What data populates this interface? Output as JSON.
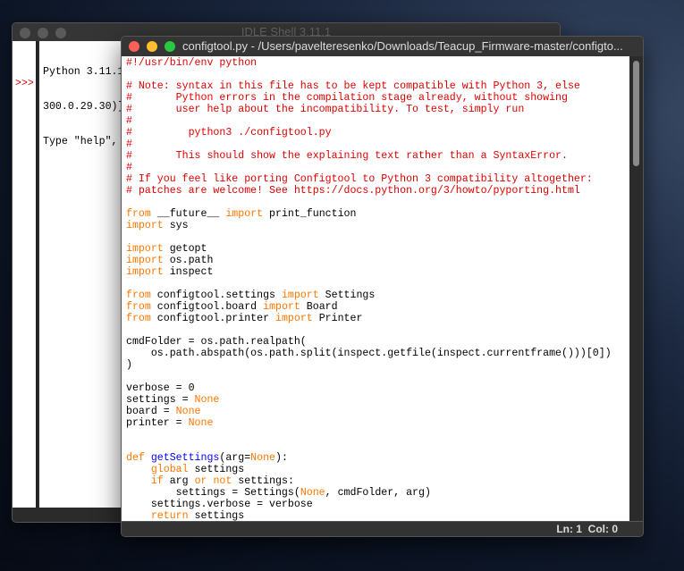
{
  "shell": {
    "title": "IDLE Shell 3.11.1",
    "lines": [
      "Python 3.11.1",
      "300.0.29.30)]",
      "Type \"help\","
    ],
    "prompt": ">>>"
  },
  "editor": {
    "title": "configtool.py - /Users/pavelteresenko/Downloads/Teacup_Firmware-master/configto...",
    "status": {
      "ln": "Ln: 1",
      "col": "Col: 0"
    },
    "lines": [
      [
        [
          "c",
          "#!/usr/bin/env python"
        ]
      ],
      [],
      [
        [
          "c",
          "# Note: syntax in this file has to be kept compatible with Python 3, else"
        ]
      ],
      [
        [
          "c",
          "#       Python errors in the compilation stage already, without showing"
        ]
      ],
      [
        [
          "c",
          "#       user help about the incompatibility. To test, simply run"
        ]
      ],
      [
        [
          "c",
          "#"
        ]
      ],
      [
        [
          "c",
          "#         python3 ./configtool.py"
        ]
      ],
      [
        [
          "c",
          "#"
        ]
      ],
      [
        [
          "c",
          "#       This should show the explaining text rather than a SyntaxError."
        ]
      ],
      [
        [
          "c",
          "#"
        ]
      ],
      [
        [
          "c",
          "# If you feel like porting Configtool to Python 3 compatibility altogether:"
        ]
      ],
      [
        [
          "c",
          "# patches are welcome! See https://docs.python.org/3/howto/pyporting.html"
        ]
      ],
      [],
      [
        [
          "k",
          "from"
        ],
        [
          "n",
          " __future__ "
        ],
        [
          "k",
          "import"
        ],
        [
          "n",
          " print_function"
        ]
      ],
      [
        [
          "k",
          "import"
        ],
        [
          "n",
          " sys"
        ]
      ],
      [],
      [
        [
          "k",
          "import"
        ],
        [
          "n",
          " getopt"
        ]
      ],
      [
        [
          "k",
          "import"
        ],
        [
          "n",
          " os.path"
        ]
      ],
      [
        [
          "k",
          "import"
        ],
        [
          "n",
          " inspect"
        ]
      ],
      [],
      [
        [
          "k",
          "from"
        ],
        [
          "n",
          " configtool.settings "
        ],
        [
          "k",
          "import"
        ],
        [
          "n",
          " Settings"
        ]
      ],
      [
        [
          "k",
          "from"
        ],
        [
          "n",
          " configtool.board "
        ],
        [
          "k",
          "import"
        ],
        [
          "n",
          " Board"
        ]
      ],
      [
        [
          "k",
          "from"
        ],
        [
          "n",
          " configtool.printer "
        ],
        [
          "k",
          "import"
        ],
        [
          "n",
          " Printer"
        ]
      ],
      [],
      [
        [
          "n",
          "cmdFolder = os.path.realpath("
        ]
      ],
      [
        [
          "n",
          "    os.path.abspath(os.path.split(inspect.getfile(inspect.currentframe()))[0])"
        ]
      ],
      [
        [
          "n",
          ")"
        ]
      ],
      [],
      [
        [
          "n",
          "verbose = 0"
        ]
      ],
      [
        [
          "n",
          "settings = "
        ],
        [
          "k",
          "None"
        ]
      ],
      [
        [
          "n",
          "board = "
        ],
        [
          "k",
          "None"
        ]
      ],
      [
        [
          "n",
          "printer = "
        ],
        [
          "k",
          "None"
        ]
      ],
      [],
      [],
      [
        [
          "k",
          "def"
        ],
        [
          "n",
          " "
        ],
        [
          "d",
          "getSettings"
        ],
        [
          "n",
          "(arg="
        ],
        [
          "k",
          "None"
        ],
        [
          "n",
          "):"
        ]
      ],
      [
        [
          "n",
          "    "
        ],
        [
          "k",
          "global"
        ],
        [
          "n",
          " settings"
        ]
      ],
      [
        [
          "n",
          "    "
        ],
        [
          "k",
          "if"
        ],
        [
          "n",
          " arg "
        ],
        [
          "k",
          "or"
        ],
        [
          "n",
          " "
        ],
        [
          "k",
          "not"
        ],
        [
          "n",
          " settings:"
        ]
      ],
      [
        [
          "n",
          "        settings = Settings("
        ],
        [
          "k",
          "None"
        ],
        [
          "n",
          ", cmdFolder, arg)"
        ]
      ],
      [
        [
          "n",
          "    settings.verbose = verbose"
        ]
      ],
      [
        [
          "n",
          "    "
        ],
        [
          "k",
          "return"
        ],
        [
          "n",
          " settings"
        ]
      ]
    ]
  },
  "colors": {
    "comment": "#dd0000",
    "keyword": "#ff7700",
    "definition": "#0000ff"
  }
}
